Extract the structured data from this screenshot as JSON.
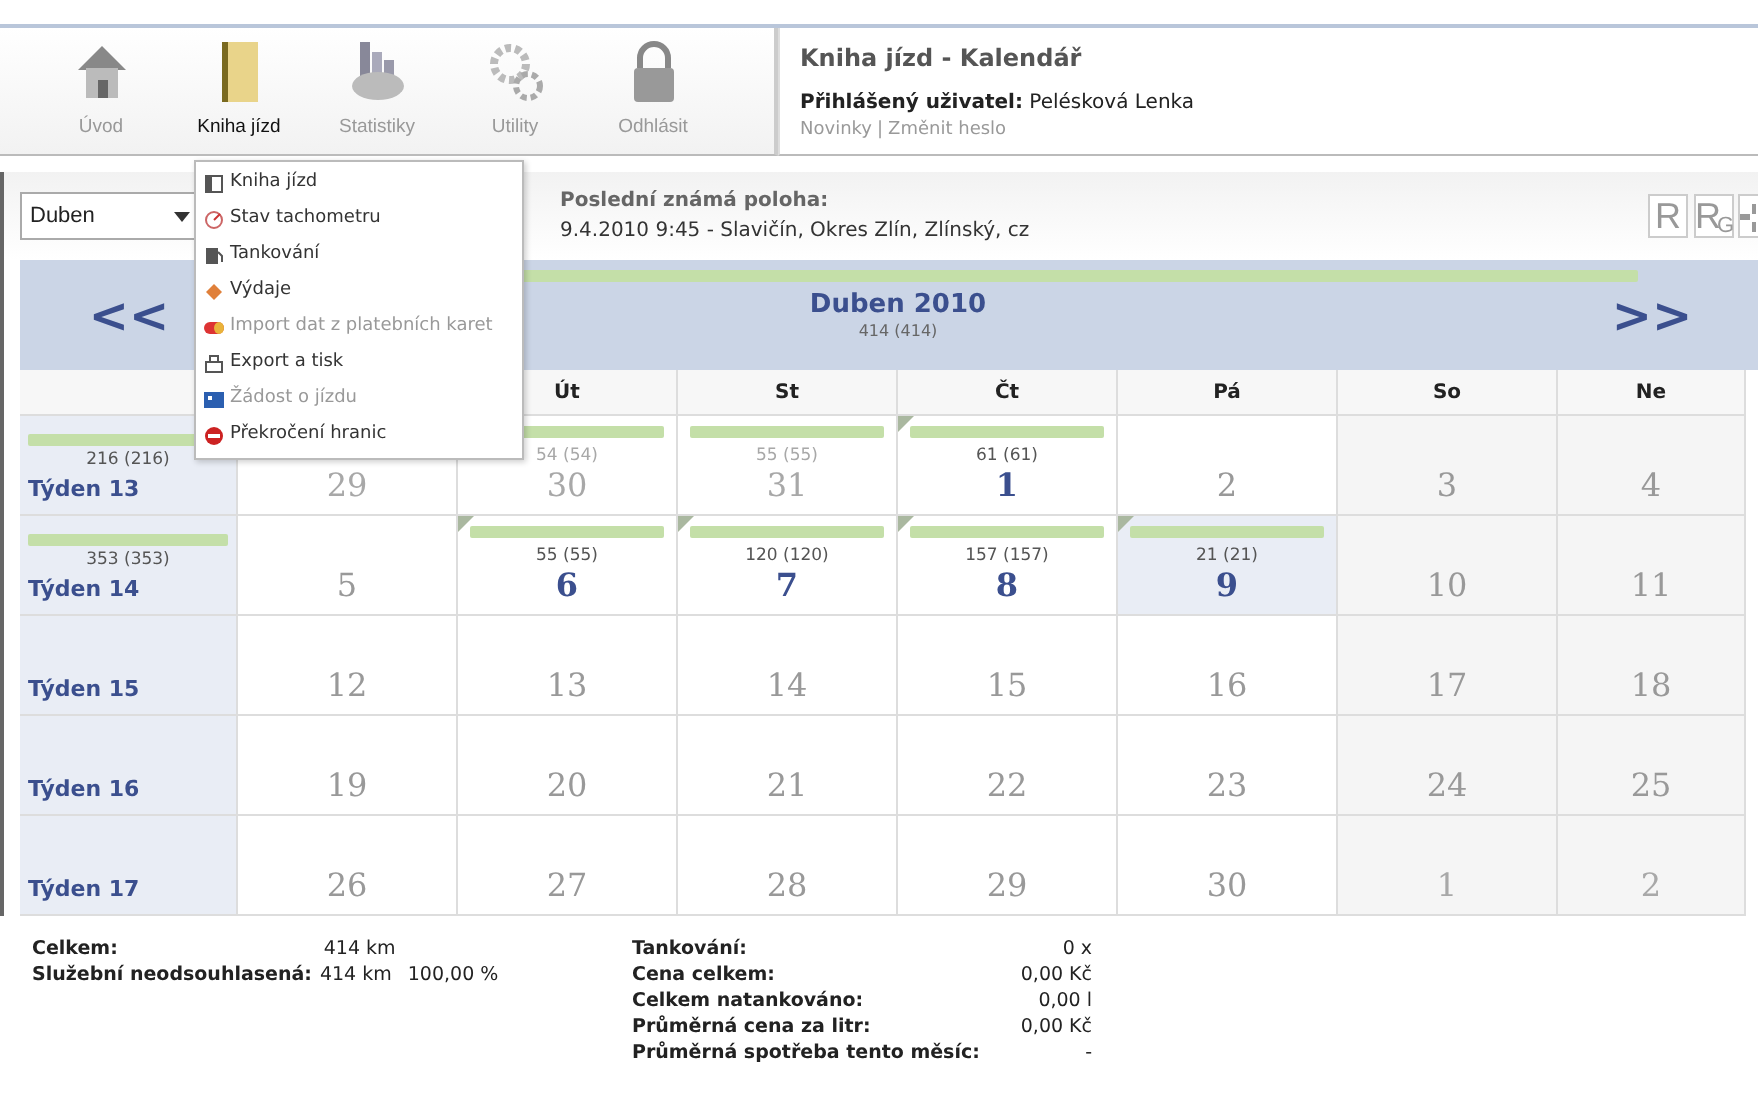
{
  "nav": [
    {
      "label": "Úvod",
      "selected": false
    },
    {
      "label": "Kniha jízd",
      "selected": true
    },
    {
      "label": "Statistiky",
      "selected": false
    },
    {
      "label": "Utility",
      "selected": false
    },
    {
      "label": "Odhlásit",
      "selected": false
    }
  ],
  "info": {
    "title": "Kniha jízd - Kalendář",
    "user_label": "Přihlášený uživatel:",
    "user": "Pelésková Lenka",
    "links": [
      "Novinky",
      "Změnit heslo"
    ],
    "separator": "|"
  },
  "menu": [
    {
      "label": "Kniha jízd",
      "disabled": false
    },
    {
      "label": "Stav tachometru",
      "disabled": false
    },
    {
      "label": "Tankování",
      "disabled": false
    },
    {
      "label": "Výdaje",
      "disabled": false
    },
    {
      "label": "Import dat z platebních karet",
      "disabled": true
    },
    {
      "label": "Export a tisk",
      "disabled": false
    },
    {
      "label": "Žádost o jízdu",
      "disabled": true
    },
    {
      "label": "Překročení hranic",
      "disabled": false
    }
  ],
  "toolbar": {
    "month": "Duben",
    "position_label": "Poslední známá poloha:",
    "position": "9.4.2010 9:45 - Slavičín, Okres Zlín, Zlínský, cz",
    "buttons": [
      "R",
      "R$_{G}$"
    ]
  },
  "calendar": {
    "prev": "<<",
    "next": ">>",
    "title": "Duben 2010",
    "total": "414 (414)",
    "days": [
      "Út",
      "St",
      "Čt",
      "Pá",
      "So",
      "Ne"
    ],
    "weeks": [
      {
        "label": "Týden 13",
        "km": "216 (216)",
        "days": [
          {
            "n": "29",
            "kind": "outside",
            "today": false
          },
          {
            "n": "30",
            "km": "54 (54)",
            "kind": "outside",
            "today": false
          },
          {
            "n": "31",
            "km": "55 (55)",
            "kind": "outside",
            "flag": false,
            "today": false
          },
          {
            "n": "1",
            "km": "61 (61)",
            "kind": "active",
            "flag": true,
            "today": false
          },
          {
            "n": "2",
            "kind": "idle",
            "flag": false,
            "today": false
          },
          {
            "n": "3",
            "kind": "idle",
            "flag": false,
            "today": false
          },
          {
            "n": "4",
            "kind": "idle",
            "flag": false,
            "today": false
          }
        ]
      },
      {
        "label": "Týden 14",
        "km": "353 (353)",
        "days": [
          {
            "n": "5",
            "kind": "idle",
            "flag": false,
            "today": false
          },
          {
            "n": "6",
            "km": "55 (55)",
            "kind": "active",
            "flag": true,
            "today": false
          },
          {
            "n": "7",
            "km": "120 (120)",
            "kind": "active",
            "flag": true,
            "today": false
          },
          {
            "n": "8",
            "km": "157 (157)",
            "kind": "active",
            "flag": true,
            "today": false
          },
          {
            "n": "9",
            "km": "21 (21)",
            "kind": "active",
            "flag": true,
            "today": true
          },
          {
            "n": "10",
            "kind": "idle",
            "flag": false,
            "today": false
          },
          {
            "n": "11",
            "kind": "idle",
            "flag": false,
            "today": false
          }
        ]
      },
      {
        "label": "Týden 15",
        "days": [
          {
            "n": "12",
            "kind": "idle",
            "flag": false,
            "today": false
          },
          {
            "n": "13",
            "kind": "idle",
            "flag": false,
            "today": false
          },
          {
            "n": "14",
            "kind": "idle",
            "flag": false,
            "today": false
          },
          {
            "n": "15",
            "kind": "idle",
            "flag": false,
            "today": false
          },
          {
            "n": "16",
            "kind": "idle",
            "flag": false,
            "today": false
          },
          {
            "n": "17",
            "kind": "idle",
            "flag": false,
            "today": false
          },
          {
            "n": "18",
            "kind": "idle",
            "flag": false,
            "today": false
          }
        ]
      },
      {
        "label": "Týden 16",
        "days": [
          {
            "n": "19",
            "kind": "idle",
            "flag": false,
            "today": false
          },
          {
            "n": "20",
            "kind": "idle",
            "flag": false,
            "today": false
          },
          {
            "n": "21",
            "kind": "idle",
            "flag": false,
            "today": false
          },
          {
            "n": "22",
            "kind": "idle",
            "flag": false,
            "today": false
          },
          {
            "n": "23",
            "kind": "idle",
            "flag": false,
            "today": false
          },
          {
            "n": "24",
            "kind": "idle",
            "flag": false,
            "today": false
          },
          {
            "n": "25",
            "kind": "idle",
            "flag": false,
            "today": false
          }
        ]
      },
      {
        "label": "Týden 17",
        "days": [
          {
            "n": "26",
            "kind": "idle",
            "flag": false,
            "today": false
          },
          {
            "n": "27",
            "kind": "idle",
            "flag": false,
            "today": false
          },
          {
            "n": "28",
            "kind": "idle",
            "flag": false,
            "today": false
          },
          {
            "n": "29",
            "kind": "idle",
            "flag": false,
            "today": false
          },
          {
            "n": "30",
            "kind": "idle",
            "flag": false,
            "today": false
          },
          {
            "n": "1",
            "kind": "outside",
            "flag": false,
            "today": false
          },
          {
            "n": "2",
            "kind": "outside",
            "flag": false,
            "today": false
          }
        ]
      }
    ]
  },
  "summary_left": [
    {
      "label": "Celkem:",
      "value": "414 km"
    },
    {
      "label": "Služební neodsouhlasená:",
      "value": "414 km",
      "extra": "100,00 %"
    }
  ],
  "summary_right": [
    {
      "label": "Tankování:",
      "value": "0 x"
    },
    {
      "label": "Cena celkem:",
      "value": "0,00 Kč"
    },
    {
      "label": "Celkem natankováno:",
      "value": "0,00 l"
    },
    {
      "label": "Průměrná cena za litr:",
      "value": "0,00 Kč"
    },
    {
      "label": "Průměrná spotřeba tento měsíc:",
      "value": "-"
    }
  ]
}
